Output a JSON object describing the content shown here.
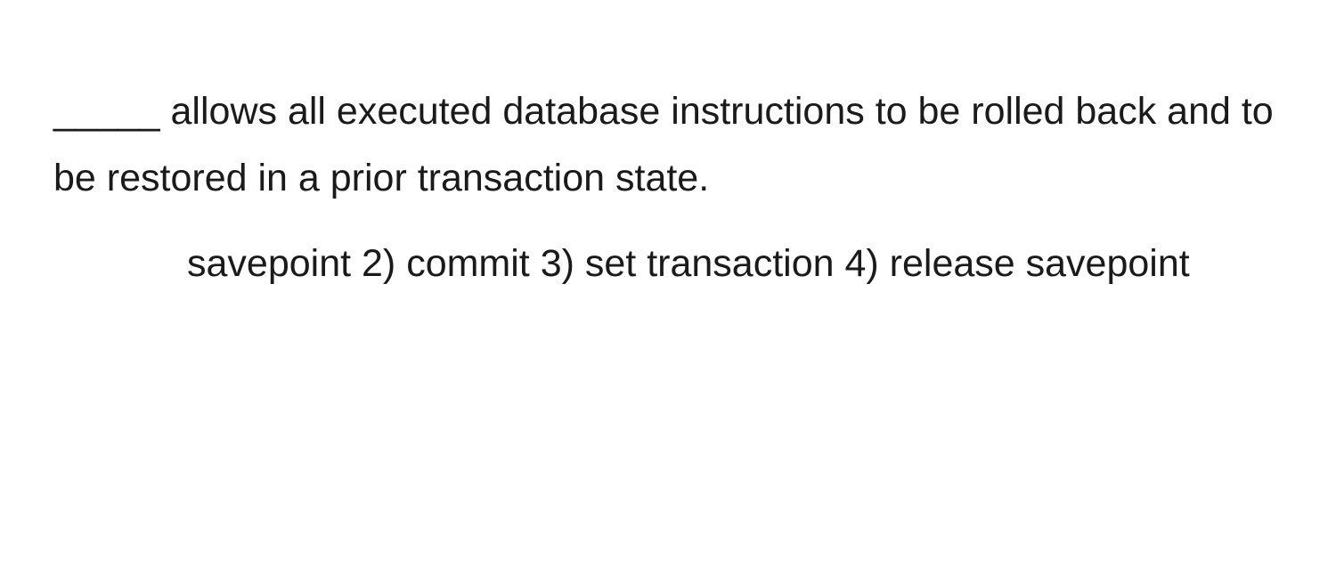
{
  "question": {
    "text": "_____ allows all executed database instructions to be rolled back and to be restored in a prior transaction state.",
    "options_line": "savepoint 2) commit 3) set transaction 4) release savepoint"
  }
}
